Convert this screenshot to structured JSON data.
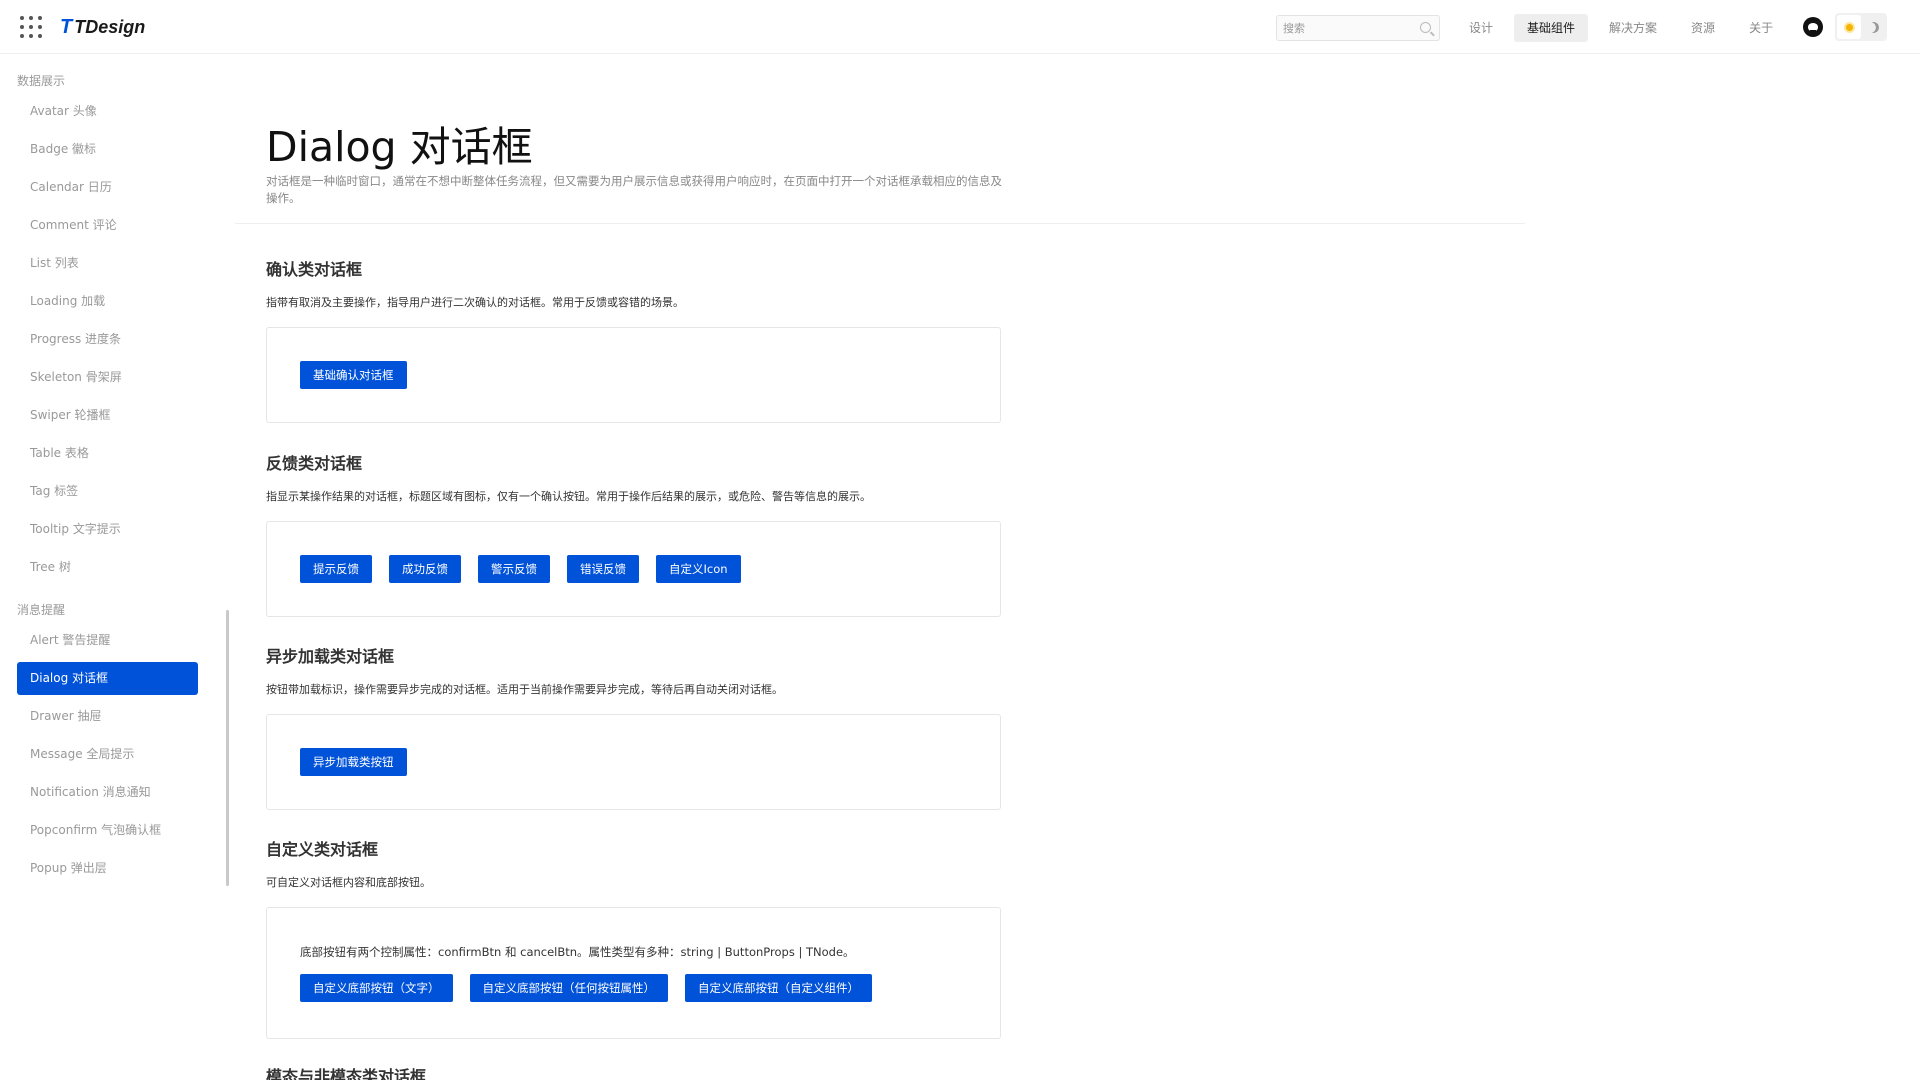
{
  "header": {
    "logo_mark": "T",
    "logo_text": "TDesign",
    "search_placeholder": "搜索",
    "nav": [
      {
        "label": "设计",
        "active": false
      },
      {
        "label": "基础组件",
        "active": true
      },
      {
        "label": "解决方案",
        "active": false
      },
      {
        "label": "资源",
        "active": false
      },
      {
        "label": "关于",
        "active": false
      }
    ]
  },
  "sidebar": {
    "groups": [
      {
        "title": "数据展示",
        "items": [
          "Avatar 头像",
          "Badge 徽标",
          "Calendar 日历",
          "Comment 评论",
          "List 列表",
          "Loading 加载",
          "Progress 进度条",
          "Skeleton 骨架屏",
          "Swiper 轮播框",
          "Table 表格",
          "Tag 标签",
          "Tooltip 文字提示",
          "Tree 树"
        ]
      },
      {
        "title": "消息提醒",
        "items": [
          "Alert 警告提醒",
          "Dialog 对话框",
          "Drawer 抽屉",
          "Message 全局提示",
          "Notification 消息通知",
          "Popconfirm 气泡确认框",
          "Popup 弹出层"
        ]
      }
    ],
    "active_item": "Dialog 对话框"
  },
  "page": {
    "title": "Dialog 对话框",
    "description": "对话框是一种临时窗口，通常在不想中断整体任务流程，但又需要为用户展示信息或获得用户响应时，在页面中打开一个对话框承载相应的信息及操作。"
  },
  "sections": [
    {
      "title": "确认类对话框",
      "desc": "指带有取消及主要操作，指导用户进行二次确认的对话框。常用于反馈或容错的场景。",
      "buttons": [
        "基础确认对话框"
      ]
    },
    {
      "title": "反馈类对话框",
      "desc": "指显示某操作结果的对话框，标题区域有图标，仅有一个确认按钮。常用于操作后结果的展示，或危险、警告等信息的展示。",
      "buttons": [
        "提示反馈",
        "成功反馈",
        "警示反馈",
        "错误反馈",
        "自定义Icon"
      ]
    },
    {
      "title": "异步加载类对话框",
      "desc": "按钮带加载标识，操作需要异步完成的对话框。适用于当前操作需要异步完成，等待后再自动关闭对话框。",
      "buttons": [
        "异步加载类按钮"
      ]
    },
    {
      "title": "自定义类对话框",
      "desc": "可自定义对话框内容和底部按钮。",
      "text": "底部按钮有两个控制属性：confirmBtn 和 cancelBtn。属性类型有多种：string | ButtonProps | TNode。",
      "buttons": [
        "自定义底部按钮（文字）",
        "自定义底部按钮（任何按钮属性）",
        "自定义底部按钮（自定义组件）"
      ]
    },
    {
      "title": "模态与非模态类对话框"
    }
  ],
  "colors": {
    "brand": "#0052d9",
    "muted_text": "#999999",
    "border": "#e6e6e6"
  },
  "icons": [
    "apps-grid-icon",
    "search-icon",
    "github-icon",
    "sun-icon",
    "moon-icon"
  ]
}
